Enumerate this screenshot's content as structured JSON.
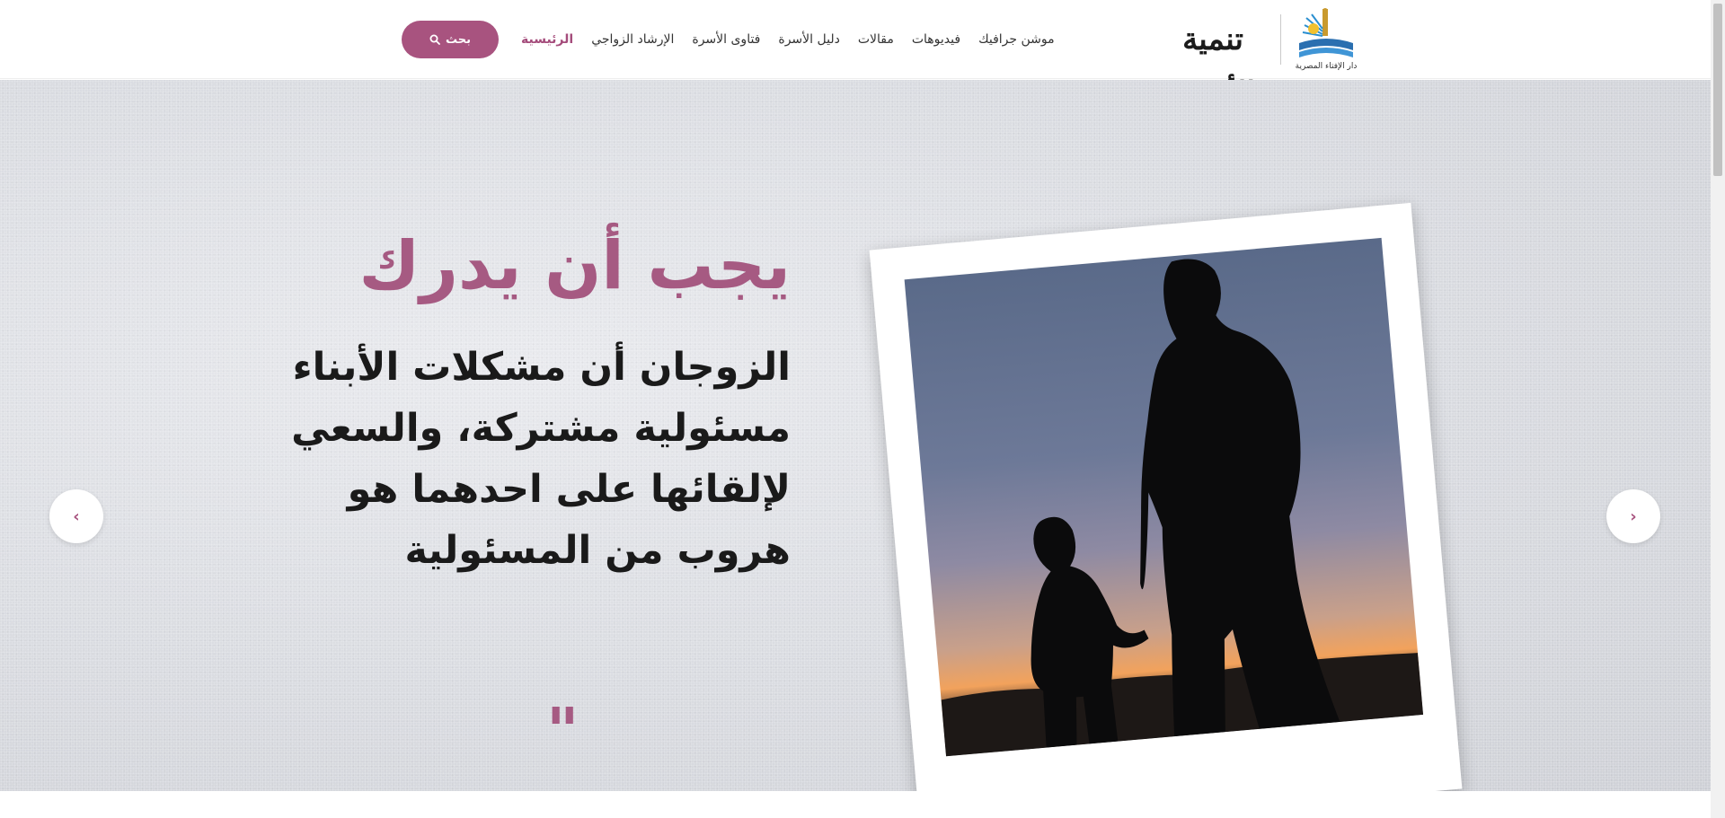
{
  "header": {
    "logo_text": "تنمية الأسرة",
    "logo_emblem_text": "دار الإفتاء المصرية",
    "nav": [
      {
        "label": "الرئيسية",
        "active": true
      },
      {
        "label": "الإرشاد الزواجي",
        "active": false
      },
      {
        "label": "فتاوى الأسرة",
        "active": false
      },
      {
        "label": "دليل الأسرة",
        "active": false
      },
      {
        "label": "مقالات",
        "active": false
      },
      {
        "label": "فيديوهات",
        "active": false
      },
      {
        "label": "موشن جرافيك",
        "active": false
      }
    ],
    "search_label": "بحث",
    "search_icon": "search-icon"
  },
  "hero": {
    "title": "يجب أن يدرك",
    "text_lines": [
      "الزوجان أن مشكلات الأبناء",
      "مسئولية مشتركة، والسعي",
      "لإلقائها على احدهما هو",
      "هروب من المسئولية"
    ],
    "quote_mark": "\"",
    "prev_icon": "chevron-left-icon",
    "next_icon": "chevron-right-icon",
    "prev_glyph": "‹",
    "next_glyph": "›"
  },
  "colors": {
    "accent": "#a8537f",
    "title": "#a65a82",
    "text": "#1a1a1a"
  }
}
